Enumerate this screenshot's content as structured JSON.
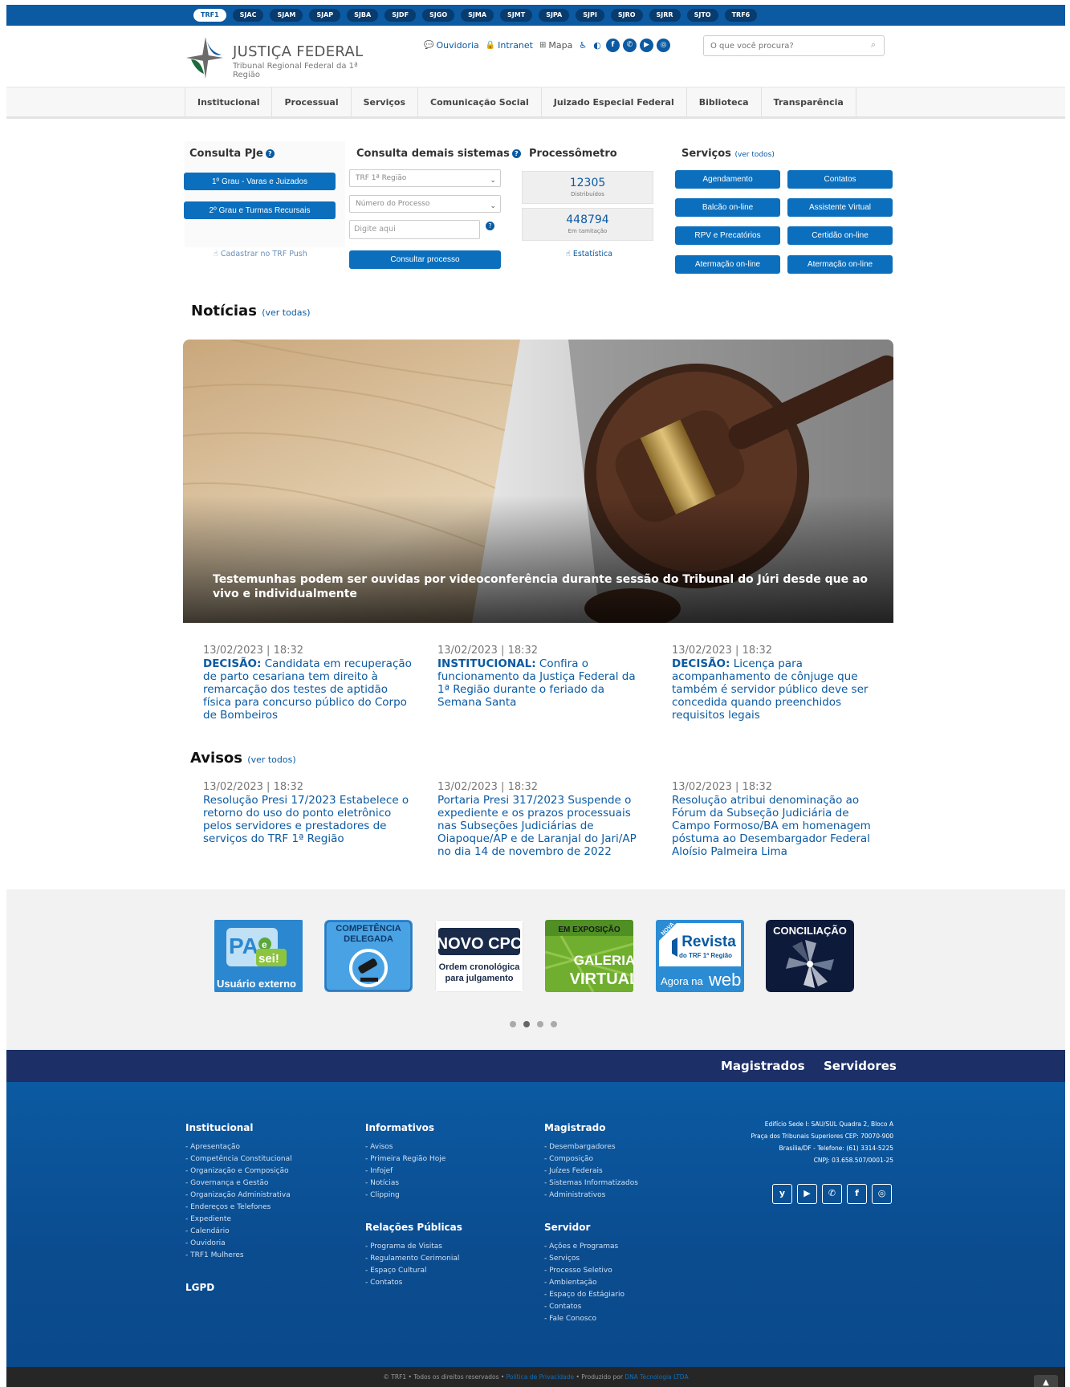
{
  "topbar": {
    "sites": [
      "TRF1",
      "SJAC",
      "SJAM",
      "SJAP",
      "SJBA",
      "SJDF",
      "SJGO",
      "SJMA",
      "SJMT",
      "SJPA",
      "SJPI",
      "SJRO",
      "SJRR",
      "SJTO",
      "TRF6"
    ]
  },
  "header": {
    "logo_title": "JUSTIÇA FEDERAL",
    "logo_subtitle": "Tribunal Regional Federal da 1ª Região",
    "links": {
      "ouvidoria": "Ouvidoria",
      "intranet": "Intranet",
      "mapa": "Mapa"
    },
    "search_placeholder": "O que você procura?"
  },
  "nav": {
    "items": [
      "Institucional",
      "Processual",
      "Serviços",
      "Comunicação Social",
      "Juizado Especial Federal",
      "Biblioteca",
      "Transparência"
    ]
  },
  "pje": {
    "title": "Consulta PJe",
    "btn1": "1º Grau - Varas e Juizados",
    "btn2": "2º Grau e Turmas Recursais",
    "push": "Cadastrar no TRF Push"
  },
  "demais": {
    "title": "Consulta demais sistemas",
    "select_regiao": "TRF 1ª Região",
    "select_tipo": "Número do Processo",
    "input_placeholder": "Digite aqui",
    "btn": "Consultar processo"
  },
  "processometro": {
    "title": "Processômetro",
    "distribuidos": "12305",
    "distribuidos_label": "Distribuídos",
    "tramitacao": "448794",
    "tramitacao_label": "Em tamitação",
    "estatistica": "Estatística"
  },
  "servicos": {
    "title": "Serviços",
    "ver_todos": "(ver todos)",
    "buttons": [
      "Agendamento",
      "Contatos",
      "Balcão on-line",
      "Assistente Virtual",
      "RPV e Precatórios",
      "Certidão on-line",
      "Atermação on-line",
      "Atermação on-line"
    ]
  },
  "noticias": {
    "title": "Notícias",
    "ver": "(ver todas)",
    "hero_caption": "Testemunhas podem ser ouvidas por videoconferência durante sessão do Tribunal do Júri desde que ao vivo e individualmente",
    "items": [
      {
        "date": "13/02/2023 | 18:32",
        "cat": "DECISÃO:",
        "text": " Candidata em recuperação de parto cesariana tem direito à remarcação dos testes de aptidão física para concurso público do Corpo de Bombeiros"
      },
      {
        "date": "13/02/2023 | 18:32",
        "cat": "INSTITUCIONAL:",
        "text": " Confira o funcionamento da Justiça Federal da 1ª Região durante o feriado da Semana Santa"
      },
      {
        "date": "13/02/2023 | 18:32",
        "cat": "DECISÃO:",
        "text": " Licença para acompanhamento de cônjuge que também é servidor público deve ser concedida quando preenchidos requisitos legais"
      }
    ]
  },
  "avisos": {
    "title": "Avisos",
    "ver": "(ver todos)",
    "items": [
      {
        "date": "13/02/2023 | 18:32",
        "text": "Resolução Presi 17/2023 Estabelece o retorno do uso do ponto eletrônico pelos servidores e prestadores de serviços do TRF 1ª Região"
      },
      {
        "date": "13/02/2023 | 18:32",
        "text": "Portaria Presi 317/2023 Suspende o expediente e os prazos processuais nas Subseções Judiciárias de Oiapoque/AP e de Laranjal do Jari/AP no dia 14 de novembro de 2022"
      },
      {
        "date": "13/02/2023 | 18:32",
        "text": "Resolução atribui denominação ao Fórum da Subseção Judiciária de Campo Formoso/BA em homenagem póstuma ao Desembargador Federal Aloísio Palmeira Lima"
      }
    ]
  },
  "banners": {
    "pae_top": "PA",
    "pae_e": "e",
    "pae_sei": "sei!",
    "pae_label": "Usuário externo",
    "comp_line1": "COMPETÊNCIA",
    "comp_line2": "DELEGADA",
    "cpc_title": "NOVO CPC",
    "cpc_line1": "Ordem cronológica",
    "cpc_line2": "para julgamento",
    "gal_top": "EM EXPOSIÇÃO",
    "gal_1": "GALERIA",
    "gal_2": "VIRTUAL",
    "rev_nova": "NOVA",
    "rev_title": "Revista",
    "rev_sub": "do TRF 1ª Região",
    "rev_agora": "Agora na",
    "rev_web": "web",
    "conc": "CONCILIAÇÃO"
  },
  "strip": {
    "magistrados": "Magistrados",
    "servidores": "Servidores"
  },
  "footer": {
    "institucional": {
      "title": "Institucional",
      "links": [
        "- Apresentação",
        "- Competência Constitucional",
        "- Organização e Composição",
        "- Governança e Gestão",
        "- Organização Administrativa",
        "- Endereços e Telefones",
        "- Expediente",
        "- Calendário",
        "- Ouvidoria",
        "- TRF1 Mulheres"
      ]
    },
    "lgpd": "LGPD",
    "informativos": {
      "title": "Informativos",
      "links": [
        "- Avisos",
        "- Primeira Região Hoje",
        "- Infojef",
        "- Notícias",
        "- Clipping"
      ]
    },
    "relacoes": {
      "title": "Relações Públicas",
      "links": [
        "- Programa de Visitas",
        "- Regulamento Cerimonial",
        "- Espaço Cultural",
        "- Contatos"
      ]
    },
    "magistrado": {
      "title": "Magistrado",
      "links": [
        "- Desembargadores",
        "- Composição",
        "- Juízes Federais",
        "- Sistemas Informatizados",
        "- Administrativos"
      ]
    },
    "servidor": {
      "title": "Servidor",
      "links": [
        "- Ações e Programas",
        "- Serviços",
        "- Processo Seletivo",
        "- Ambientação",
        "- Espaço do Estágiario",
        "- Contatos",
        "- Fale Conosco"
      ]
    },
    "address": [
      "Edifício Sede I: SAU/SUL Quadra 2, Bloco A",
      "Praça dos Tribunais Superiores CEP: 70070-900",
      "Brasília/DF - Telefone: (61) 3314-5225",
      "CNPJ: 03.658.507/0001-25"
    ]
  },
  "bottom": {
    "prefix": "© TRF1 • Todos os direitos reservados • ",
    "privacy": "Política de Privacidade",
    "mid": " • Produzido por ",
    "dna": "DNA Tecnologia LTDA"
  },
  "colors": {
    "brand_blue": "#0b5aa2",
    "button_blue": "#0b6fbd",
    "navy": "#1c2f66",
    "footer_blue": "#0b4c8f"
  }
}
